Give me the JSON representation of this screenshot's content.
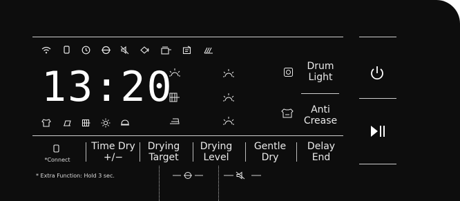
{
  "display": {
    "time": "13:20"
  },
  "top_icons": [
    "wifi-icon",
    "phone-icon",
    "clock-icon",
    "eco-icon",
    "mute-icon",
    "dryer-icon",
    "child-lock-icon",
    "time-icon",
    "leaf-icon"
  ],
  "bottom_icons": [
    "shirt-icon",
    "towel-icon",
    "grid-icon",
    "sun-icon",
    "cap-icon"
  ],
  "dry_levels": {
    "left": [
      "sun-icon",
      "grid-icon",
      "iron-icon"
    ],
    "right": [
      "sun-icon",
      "sun-icon",
      "sun-icon"
    ]
  },
  "right_options": {
    "drum_light": "Drum\nLight",
    "anti_crease": "Anti\nCrease"
  },
  "buttons": {
    "connect": "*Connect",
    "time_dry": "Time Dry\n+/−",
    "drying_target": "Drying\nTarget",
    "drying_level": "Drying\nLevel",
    "gentle_dry": "Gentle\nDry",
    "delay_end": "Delay\nEnd"
  },
  "footnote": "* Extra Function: Hold 3 sec.",
  "colors": {
    "panel": "#0d0d0d",
    "text": "#eaeaea"
  }
}
